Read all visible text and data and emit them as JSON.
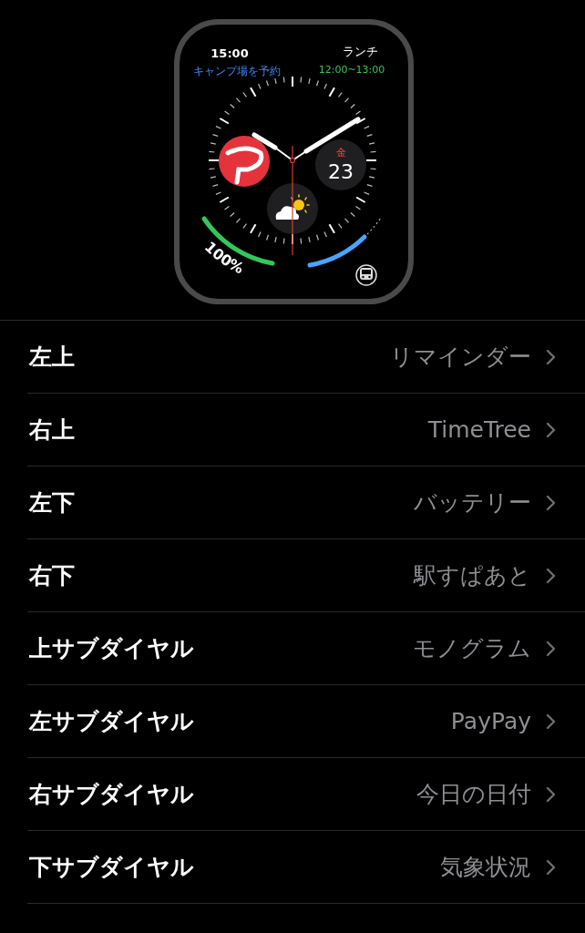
{
  "watch_face": {
    "top_left": {
      "time": "15:00",
      "title": "キャンプ場を予約"
    },
    "top_right": {
      "title": "ランチ",
      "time": "12:00~13:00"
    },
    "date": {
      "weekday": "金",
      "day": "23"
    },
    "battery": {
      "reading": "100%"
    }
  },
  "rows": [
    {
      "label": "左上",
      "value": "リマインダー"
    },
    {
      "label": "右上",
      "value": "TimeTree"
    },
    {
      "label": "左下",
      "value": "バッテリー"
    },
    {
      "label": "右下",
      "value": "駅すぱあと"
    },
    {
      "label": "上サブダイヤル",
      "value": "モノグラム"
    },
    {
      "label": "左サブダイヤル",
      "value": "PayPay"
    },
    {
      "label": "右サブダイヤル",
      "value": "今日の日付"
    },
    {
      "label": "下サブダイヤル",
      "value": "気象状況"
    }
  ]
}
